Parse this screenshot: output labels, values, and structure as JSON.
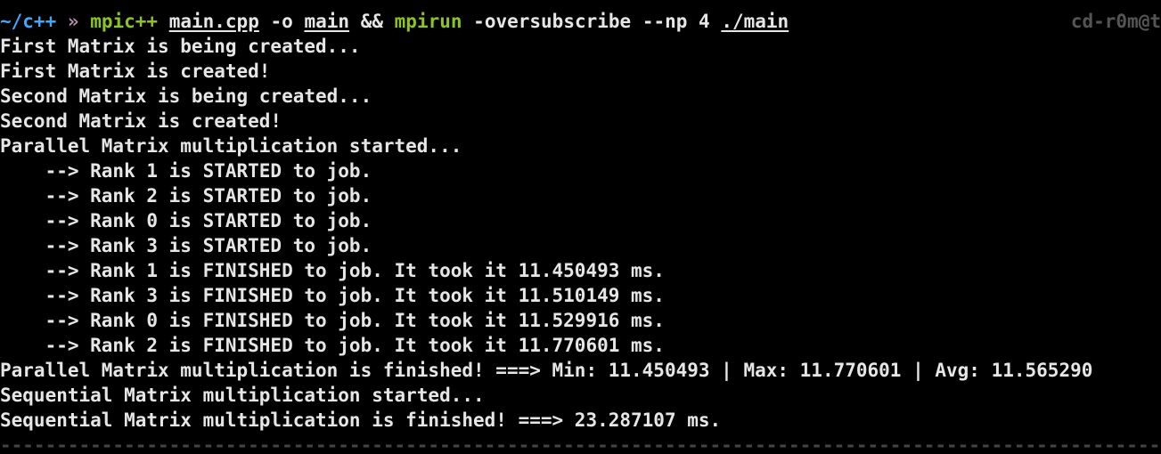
{
  "colors": {
    "background": "#000000",
    "text": "#e6e6e6",
    "path": "#3fa7ff",
    "prompt_arrow": "#b48ead",
    "command": "#8dc41f",
    "right_prompt": "#555555",
    "divider": "#444444"
  },
  "prompt": {
    "path": "~/c++",
    "arrow": "»",
    "command": "mpic++",
    "arg1": "main.cpp",
    "flag": "-o",
    "arg2": "main",
    "chain": "&&",
    "command2": "mpirun",
    "args2": "-oversubscribe --np 4",
    "target": "./main",
    "right_prompt": "cd-r0m@t"
  },
  "output_lines": [
    "First Matrix is being created...",
    "First Matrix is created!",
    "Second Matrix is being created...",
    "Second Matrix is created!",
    "Parallel Matrix multiplication started...",
    "    --> Rank 1 is STARTED to job.",
    "    --> Rank 2 is STARTED to job.",
    "    --> Rank 0 is STARTED to job.",
    "    --> Rank 3 is STARTED to job.",
    "    --> Rank 1 is FINISHED to job. It took it 11.450493 ms.",
    "    --> Rank 3 is FINISHED to job. It took it 11.510149 ms.",
    "    --> Rank 0 is FINISHED to job. It took it 11.529916 ms.",
    "    --> Rank 2 is FINISHED to job. It took it 11.770601 ms.",
    "Parallel Matrix multiplication is finished! ===> Min: 11.450493 | Max: 11.770601 | Avg: 11.565290",
    "Sequential Matrix multiplication started...",
    "Sequential Matrix multiplication is finished! ===> 23.287107 ms."
  ],
  "divider": "----------------------------------------------------------------------------------------------------------------------------------------------------------------------------------------------------"
}
